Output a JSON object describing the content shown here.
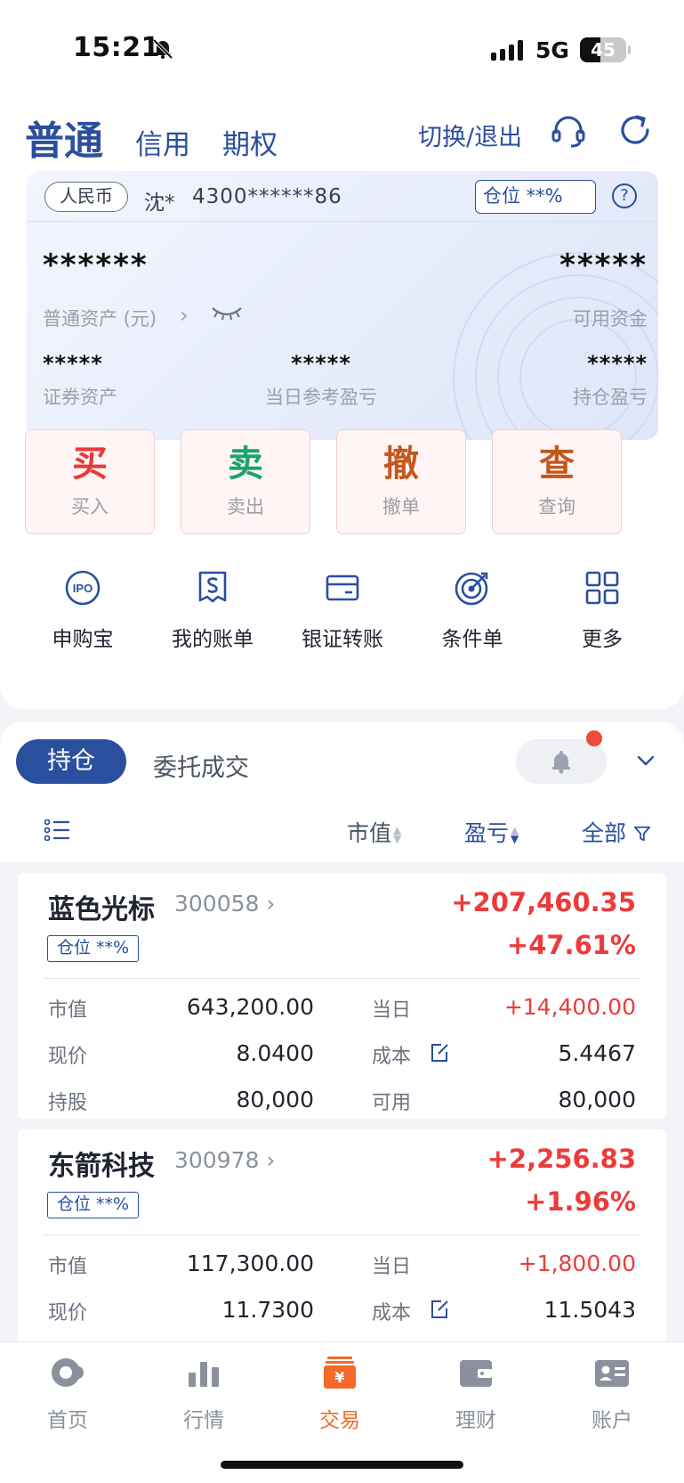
{
  "status_bar": {
    "time": "15:21",
    "network": "5G",
    "battery": "45",
    "battery_level": 0.45
  },
  "header": {
    "tabs": [
      "普通",
      "信用",
      "期权"
    ],
    "switch_label": "切换/退出"
  },
  "account": {
    "currency": "人民币",
    "holder": "沈*",
    "number": "4300******86",
    "position_label": "仓位 **%",
    "help": "?",
    "total_value": "******",
    "total_label": "普通资产 (元)",
    "total_arrow": "›",
    "available_value": "*****",
    "available_label": "可用资金",
    "stats": [
      {
        "value": "*****",
        "label": "证券资产"
      },
      {
        "value": "*****",
        "label": "当日参考盈亏"
      },
      {
        "value": "*****",
        "label": "持仓盈亏"
      }
    ]
  },
  "trade_buttons": [
    {
      "char": "买",
      "label": "买入",
      "color": "#e83a3a"
    },
    {
      "char": "卖",
      "label": "卖出",
      "color": "#1aa36b"
    },
    {
      "char": "撤",
      "label": "撤单",
      "color": "#c4571e"
    },
    {
      "char": "查",
      "label": "查询",
      "color": "#c4571e"
    }
  ],
  "shortcuts": [
    {
      "icon": "ipo-icon",
      "label": "申购宝"
    },
    {
      "icon": "bill-icon",
      "label": "我的账单"
    },
    {
      "icon": "card-icon",
      "label": "银证转账"
    },
    {
      "icon": "target-icon",
      "label": "条件单"
    },
    {
      "icon": "grid-icon",
      "label": "更多"
    }
  ],
  "holdings_section": {
    "tab_active": "持仓",
    "tab_other": "委托成交",
    "sort_market_value": "市值",
    "sort_pl": "盈亏",
    "filter": "全部"
  },
  "positions": [
    {
      "name": "蓝色光标",
      "code": "300058",
      "pl": "+207,460.35",
      "pl_pct": "+47.61%",
      "badge": "仓位 **%",
      "rows": [
        {
          "k1": "市值",
          "v1": "643,200.00",
          "k2": "当日",
          "v2": "+14,400.00",
          "v2_red": true
        },
        {
          "k1": "现价",
          "v1": "8.0400",
          "k2": "成本",
          "v2": "5.4467",
          "v2_red": false
        },
        {
          "k1": "持股",
          "v1": "80,000",
          "k2": "可用",
          "v2": "80,000",
          "v2_red": false
        }
      ]
    },
    {
      "name": "东箭科技",
      "code": "300978",
      "pl": "+2,256.83",
      "pl_pct": "+1.96%",
      "badge": "仓位 **%",
      "rows": [
        {
          "k1": "市值",
          "v1": "117,300.00",
          "k2": "当日",
          "v2": "+1,800.00",
          "v2_red": true
        },
        {
          "k1": "现价",
          "v1": "11.7300",
          "k2": "成本",
          "v2": "11.5043",
          "v2_red": false
        }
      ]
    }
  ],
  "bottom_nav": [
    {
      "label": "首页",
      "icon": "home-icon",
      "active": false
    },
    {
      "label": "行情",
      "icon": "market-icon",
      "active": false
    },
    {
      "label": "交易",
      "icon": "trade-icon",
      "active": true
    },
    {
      "label": "理财",
      "icon": "wallet-icon",
      "active": false
    },
    {
      "label": "账户",
      "icon": "account-icon",
      "active": false
    }
  ],
  "colors": {
    "brand": "#2a4f9e",
    "up": "#ec3b3b",
    "active_nav": "#f26b2a"
  }
}
